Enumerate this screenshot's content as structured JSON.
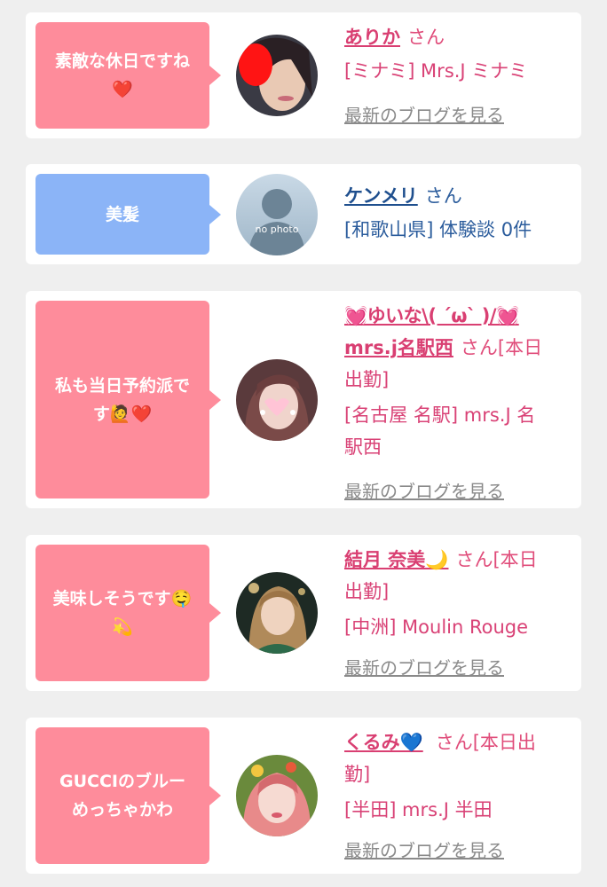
{
  "cards": [
    {
      "message": "素敵な休日ですね",
      "message_emoji": "❤️",
      "name": "ありか",
      "honorific": "さん",
      "detail": "[ミナミ] Mrs.J ミナミ",
      "link": "最新のブログを見る",
      "color": "#fe8c9b"
    },
    {
      "message": "美髪",
      "name": "ケンメリ",
      "honorific": "さん",
      "detail": "[和歌山県] 体験談 0件",
      "avatar_caption": "no photo",
      "color": "#8bb4f7"
    },
    {
      "message": "私も当日予約派で",
      "message_line2": "す🙋❤️",
      "name_line1": "💓ゆいな\\( ´ω` )/💓",
      "name_line2": "mrs.j名駅西",
      "honorific": "さん[本日",
      "honorific_cont": "出勤]",
      "detail_line1": "[名古屋 名駅] mrs.J 名",
      "detail_line2": "駅西",
      "link": "最新のブログを見る",
      "color": "#fe8c9b"
    },
    {
      "message": "美味しそうです🤤",
      "message_line2": "💫",
      "name": "結月 奈美🌙",
      "honorific": "さん[本日",
      "honorific_cont": "出勤]",
      "detail": "[中洲] Moulin Rouge",
      "link": "最新のブログを見る",
      "color": "#fe8c9b"
    },
    {
      "message": "GUCCIのブルー",
      "message_line2": "めっちゃかわ",
      "name": "くるみ💙",
      "honorific": "さん[本日出",
      "honorific_cont": "勤]",
      "detail": "[半田] mrs.J 半田",
      "link": "最新のブログを見る",
      "color": "#fe8c9b"
    }
  ]
}
